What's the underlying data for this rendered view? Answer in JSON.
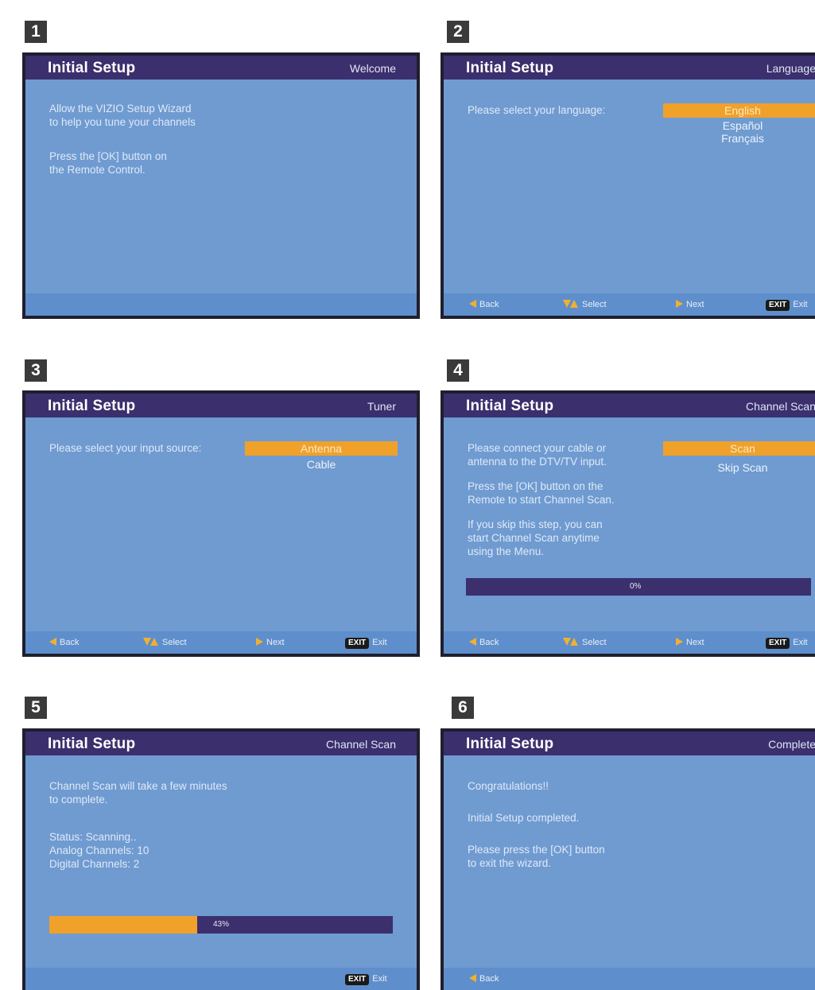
{
  "steps": [
    {
      "number": "1",
      "title": "Initial  Setup",
      "page": "Welcome",
      "body": [
        "Allow the VIZIO Setup Wizard\nto help you tune your channels",
        "Press the [OK] button on\nthe Remote Control."
      ]
    },
    {
      "number": "2",
      "title": "Initial  Setup",
      "page": "Language",
      "prompt": "Please select your language:",
      "options": [
        "English",
        "Español",
        "Français"
      ],
      "selected": "English",
      "footer": {
        "back": "Back",
        "select": "Select",
        "next": "Next",
        "exit_key": "EXIT",
        "exit": "Exit"
      }
    },
    {
      "number": "3",
      "title": "Initial  Setup",
      "page": "Tuner",
      "prompt": "Please select your input source:",
      "options": [
        "Antenna",
        "Cable"
      ],
      "selected": "Antenna",
      "footer": {
        "back": "Back",
        "select": "Select",
        "next": "Next",
        "exit_key": "EXIT",
        "exit": "Exit"
      }
    },
    {
      "number": "4",
      "title": "Initial  Setup",
      "page": "Channel Scan",
      "body": [
        "Please connect your cable or\nantenna to the DTV/TV input.",
        "Press the [OK] button on the\nRemote to start Channel Scan.",
        "If you skip this step, you can\nstart Channel Scan anytime\nusing the Menu."
      ],
      "options": [
        "Scan",
        "Skip Scan"
      ],
      "selected": "Scan",
      "progress_label": "0%",
      "progress": 0,
      "footer": {
        "back": "Back",
        "select": "Select",
        "next": "Next",
        "exit_key": "EXIT",
        "exit": "Exit"
      }
    },
    {
      "number": "5",
      "title": "Initial  Setup",
      "page": "Channel Scan",
      "body": [
        "Channel Scan will take a few minutes\nto complete.",
        "Status: Scanning..\nAnalog Channels: 10\nDigital Channels: 2"
      ],
      "progress_label": "43%",
      "progress": 0.43,
      "footer": {
        "exit_key": "EXIT",
        "exit": "Exit"
      }
    },
    {
      "number": "6",
      "title": "Initial  Setup",
      "page": "Complete",
      "body": [
        "Congratulations!!",
        "Initial Setup completed.",
        "Please press the [OK] button\nto exit the wizard."
      ],
      "footer": {
        "back": "Back"
      }
    }
  ],
  "colors": {
    "header": "#3c2f6d",
    "screen": "#6f9bd1",
    "highlight": "#f0a12a",
    "frame": "#1f1f2e"
  }
}
